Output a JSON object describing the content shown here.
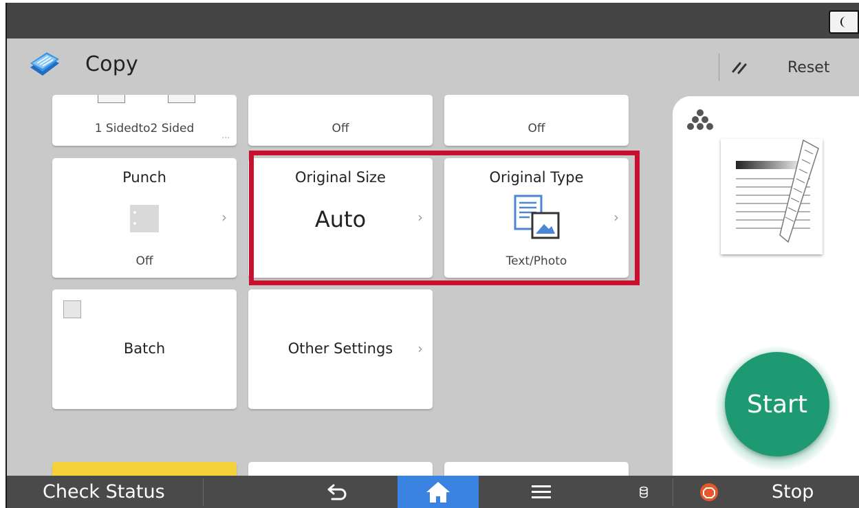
{
  "app": {
    "title": "Copy",
    "reset_label": "Reset"
  },
  "tiles_top": [
    {
      "value": "1 Sidedto2 Sided"
    },
    {
      "value": "Off"
    },
    {
      "value": "Off"
    }
  ],
  "tiles": {
    "punch": {
      "title": "Punch",
      "value": "Off"
    },
    "original_size": {
      "title": "Original Size",
      "value": "Auto"
    },
    "original_type": {
      "title": "Original Type",
      "value": "Text/Photo"
    },
    "batch": {
      "title": "Batch"
    },
    "other_settings": {
      "title": "Other Settings"
    }
  },
  "chevron": "›",
  "more_dots": "...",
  "start_label": "Start",
  "bottom": {
    "check_status": "Check Status",
    "stop": "Stop"
  },
  "colors": {
    "highlight": "#c8102e",
    "start": "#1d9a71",
    "home": "#3a83e0",
    "stop_icon": "#e8572a"
  },
  "icons": [
    "moon-icon",
    "copy-app-icon",
    "reset-icon",
    "punch-icon",
    "original-type-icon",
    "toner-icon",
    "back-icon",
    "home-icon",
    "menu-icon",
    "memory-icon",
    "stop-icon"
  ]
}
